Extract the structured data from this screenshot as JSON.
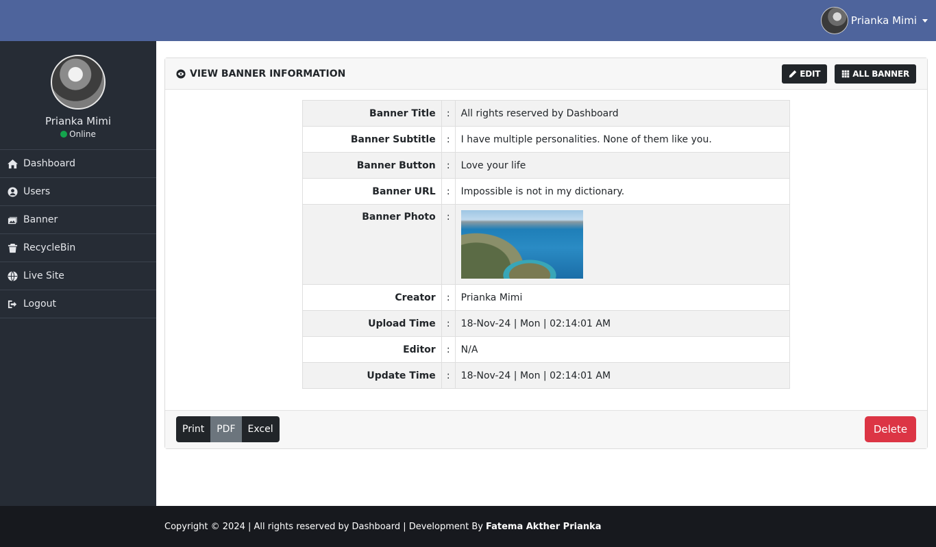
{
  "header": {
    "user_name": "Prianka Mimi"
  },
  "sidebar": {
    "profile_name": "Prianka Mimi",
    "status": "Online",
    "items": [
      {
        "label": "Dashboard",
        "icon": "home-icon"
      },
      {
        "label": "Users",
        "icon": "user-circle-icon"
      },
      {
        "label": "Banner",
        "icon": "images-icon"
      },
      {
        "label": "RecycleBin",
        "icon": "trash-icon"
      },
      {
        "label": "Live Site",
        "icon": "globe-icon"
      },
      {
        "label": "Logout",
        "icon": "sign-out-icon"
      }
    ]
  },
  "card": {
    "title": "VIEW BANNER INFORMATION",
    "edit_label": "EDIT",
    "all_banner_label": "ALL BANNER",
    "separator": ":",
    "rows": [
      {
        "label": "Banner Title",
        "value": "All rights reserved by Dashboard"
      },
      {
        "label": "Banner Subtitle",
        "value": "I have multiple personalities. None of them like you."
      },
      {
        "label": "Banner Button",
        "value": "Love your life"
      },
      {
        "label": "Banner URL",
        "value": "Impossible is not in my dictionary."
      },
      {
        "label": "Banner Photo",
        "value": ""
      },
      {
        "label": "Creator",
        "value": "Prianka Mimi"
      },
      {
        "label": "Upload Time",
        "value": "18-Nov-24 | Mon | 02:14:01 AM"
      },
      {
        "label": "Editor",
        "value": "N/A"
      },
      {
        "label": "Update Time",
        "value": "18-Nov-24 | Mon | 02:14:01 AM"
      }
    ],
    "export": {
      "print": "Print",
      "pdf": "PDF",
      "excel": "Excel"
    },
    "delete_label": "Delete"
  },
  "footer": {
    "text": "Copyright © 2024 | All rights reserved by Dashboard | Development By",
    "author": "Fatema Akther Prianka"
  },
  "colors": {
    "topbar": "#4e649c",
    "sidebar": "#262c35",
    "footer": "#17191e",
    "danger": "#dc3545",
    "online": "#14a44d"
  }
}
